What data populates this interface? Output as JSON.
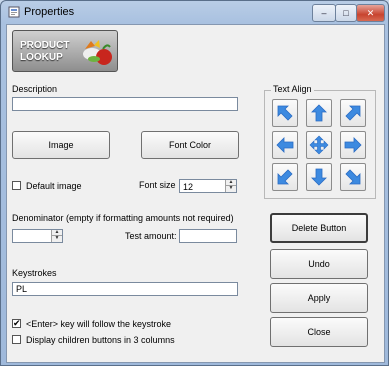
{
  "window": {
    "title": "Properties",
    "min_glyph": "–",
    "max_glyph": "□",
    "close_glyph": "✕"
  },
  "product_button": {
    "line1": "PRODUCT",
    "line2": "LOOKUP"
  },
  "description": {
    "label": "Description",
    "value": ""
  },
  "buttons": {
    "image": "Image",
    "font_color": "Font Color",
    "delete": "Delete Button",
    "undo": "Undo",
    "apply": "Apply",
    "close": "Close"
  },
  "default_image": {
    "label": "Default image",
    "checked": false
  },
  "font_size": {
    "label": "Font size",
    "value": "12"
  },
  "denominator": {
    "label": "Denominator (empty if formatting amounts not required)",
    "value": ""
  },
  "test_amount": {
    "label": "Test amount:",
    "value": ""
  },
  "keystrokes": {
    "label": "Keystrokes",
    "value": "PL"
  },
  "enter_follow": {
    "label": "<Enter> key will follow the keystroke",
    "checked": true,
    "mark": "✔"
  },
  "three_columns": {
    "label": "Display children buttons in 3 columns",
    "checked": false
  },
  "text_align": {
    "label": "Text Align",
    "buttons": [
      "top-left",
      "top",
      "top-right",
      "left",
      "center",
      "right",
      "bottom-left",
      "bottom",
      "bottom-right"
    ]
  },
  "colors": {
    "accent": "#3d8ae0",
    "arrow_dark": "#2a6cc4"
  }
}
